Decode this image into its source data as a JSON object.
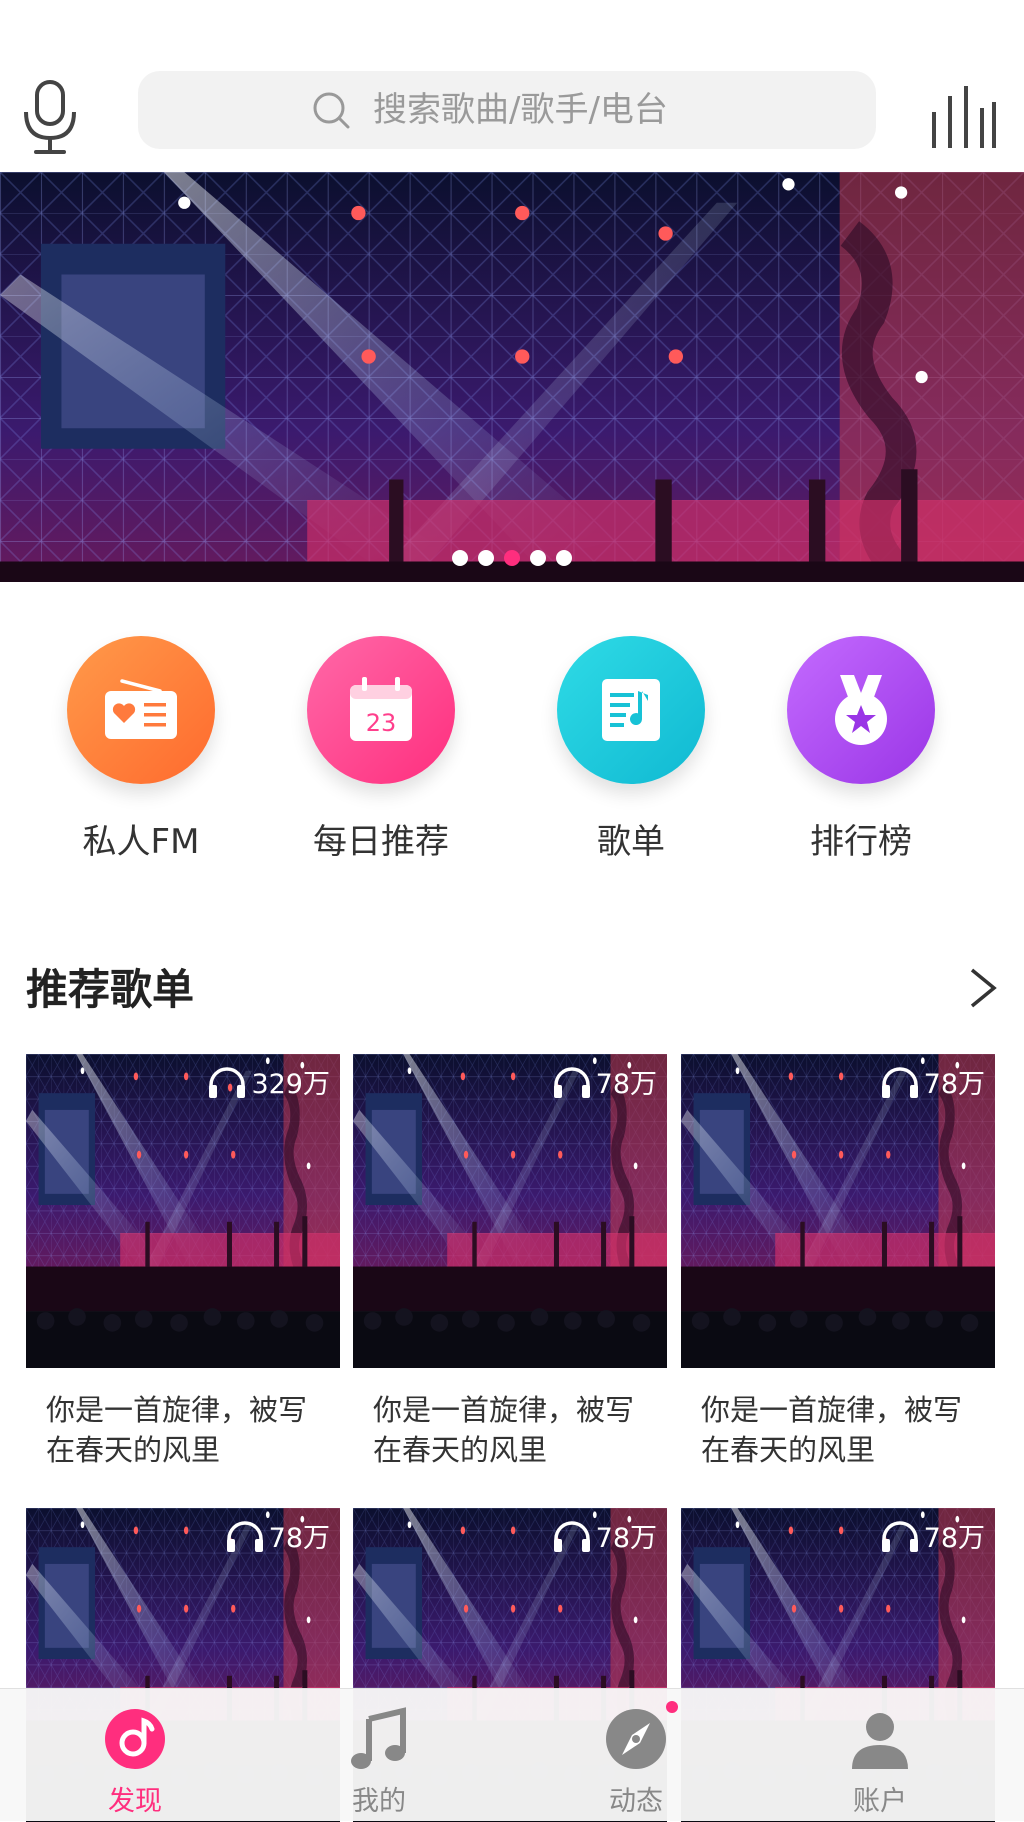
{
  "search": {
    "placeholder": "搜索歌曲/歌手/电台"
  },
  "banner": {
    "slide_count": 5,
    "active_index": 2
  },
  "entries": [
    {
      "label": "私人FM",
      "icon": "radio-icon",
      "color": "#ff7a3d"
    },
    {
      "label": "每日推荐",
      "icon": "calendar-icon",
      "day": "23",
      "color": "#ff3f8c"
    },
    {
      "label": "歌单",
      "icon": "playlist-icon",
      "color": "#1ccbd9"
    },
    {
      "label": "排行榜",
      "icon": "medal-icon",
      "color": "#b24ff0"
    }
  ],
  "section": {
    "title": "推荐歌单"
  },
  "playlists": [
    {
      "plays": "329万",
      "title": "你是一首旋律，被写在春天的风里"
    },
    {
      "plays": "78万",
      "title": "你是一首旋律，被写在春天的风里"
    },
    {
      "plays": "78万",
      "title": "你是一首旋律，被写在春天的风里"
    },
    {
      "plays": "78万",
      "title": ""
    },
    {
      "plays": "78万",
      "title": ""
    },
    {
      "plays": "78万",
      "title": ""
    }
  ],
  "tabs": [
    {
      "label": "发现",
      "icon": "discover-icon",
      "active": true
    },
    {
      "label": "我的",
      "icon": "music-note-icon",
      "active": false
    },
    {
      "label": "动态",
      "icon": "compass-icon",
      "active": false,
      "badge": true
    },
    {
      "label": "账户",
      "icon": "user-icon",
      "active": false
    }
  ],
  "colors": {
    "accent": "#ff2e7e",
    "search_bg": "#f2f2f2"
  }
}
